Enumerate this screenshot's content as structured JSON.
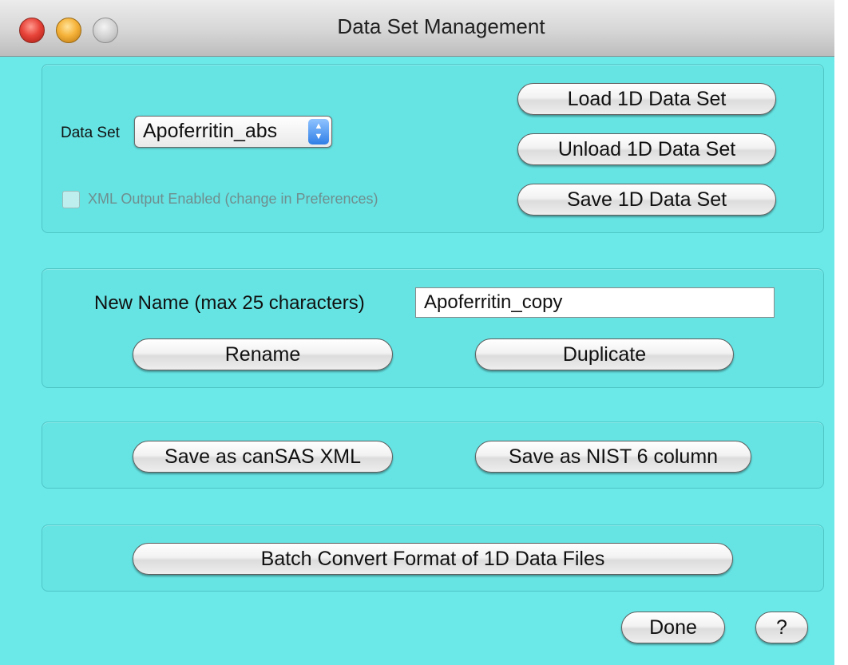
{
  "window": {
    "title": "Data Set Management"
  },
  "data_set_panel": {
    "data_set_label": "Data Set",
    "data_set_selected": "Apoferritin_abs",
    "xml_output_label": "XML Output Enabled (change in Preferences)",
    "xml_output_checked": false,
    "load_button": "Load 1D Data Set",
    "unload_button": "Unload 1D Data Set",
    "save_button": "Save 1D Data Set"
  },
  "rename_panel": {
    "new_name_label": "New Name (max 25 characters)",
    "new_name_value": "Apoferritin_copy",
    "rename_button": "Rename",
    "duplicate_button": "Duplicate"
  },
  "export_panel": {
    "cansas_button": "Save as canSAS XML",
    "nist_button": "Save as NIST 6 column"
  },
  "batch_panel": {
    "batch_button": "Batch Convert Format of 1D Data Files"
  },
  "footer": {
    "done_button": "Done",
    "help_button": "?"
  },
  "colors": {
    "window_background": "#6be8e8",
    "select_arrow": "#2f7fe6"
  }
}
